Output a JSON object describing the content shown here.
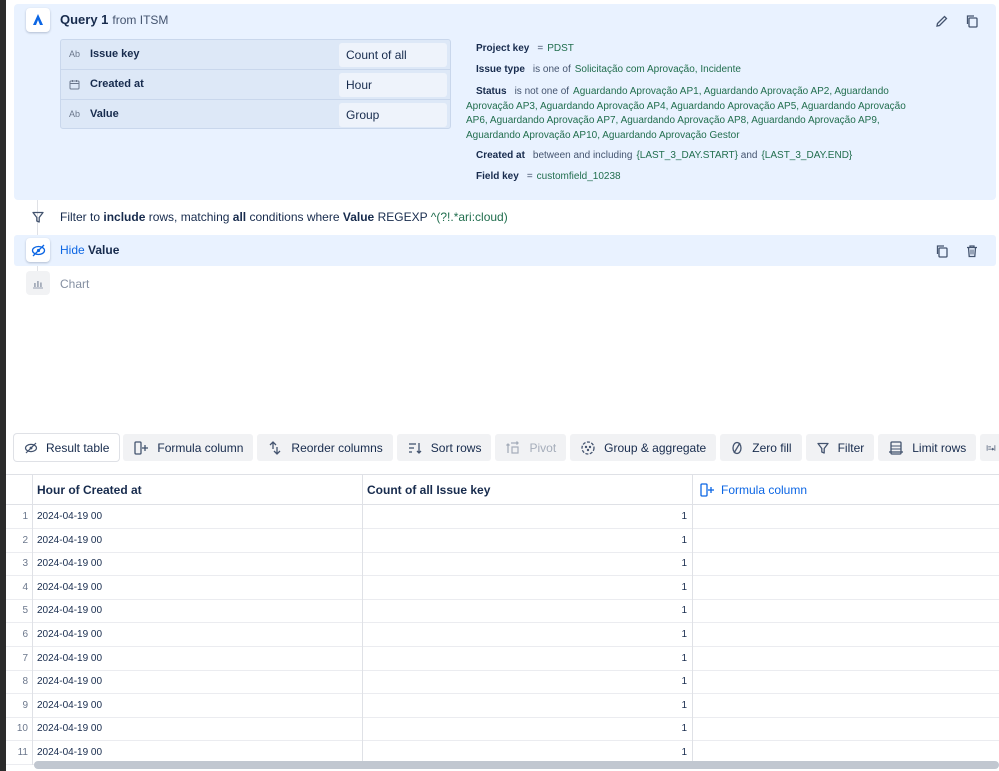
{
  "query": {
    "title": "Query 1",
    "from_label": "from",
    "source": "ITSM",
    "fields": [
      {
        "type": "Ab",
        "name": "Issue key",
        "aggregation": "Count of all"
      },
      {
        "type": "",
        "name": "Created at",
        "aggregation": "Hour"
      },
      {
        "type": "Ab",
        "name": "Value",
        "aggregation": "Group"
      }
    ],
    "conditions": {
      "project": {
        "key": "Project key",
        "op": "=",
        "value": "PDST"
      },
      "issue_type": {
        "key": "Issue type",
        "op": "is one of",
        "values": "Solicitação com Aprovação,  Incidente"
      },
      "status": {
        "key": "Status",
        "op": "is not one of",
        "values": "Aguardando Aprovação AP1,  Aguardando Aprovação AP2,  Aguardando Aprovação AP3,  Aguardando Aprovação AP4,  Aguardando Aprovação AP5,  Aguardando Aprovação AP6,  Aguardando Aprovação AP7,  Aguardando Aprovação AP8,  Aguardando Aprovação AP9,  Aguardando Aprovação AP10,  Aguardando Aprovação Gestor"
      },
      "created_at": {
        "key": "Created at",
        "op": "between and including",
        "start": "{LAST_3_DAY.START}",
        "and": "and",
        "end": "{LAST_3_DAY.END}"
      },
      "field_key": {
        "key": "Field key",
        "op": "=",
        "value": "customfield_10238"
      }
    }
  },
  "filter_step": {
    "t1": "Filter to",
    "include": "include",
    "t2": "rows, matching",
    "all": "all",
    "t3": "conditions where",
    "field": "Value",
    "op": "REGEXP",
    "pattern": "^(?!.*ari:cloud)"
  },
  "hide_step": {
    "action": "Hide",
    "field": "Value"
  },
  "chart_step": {
    "label": "Chart"
  },
  "toolbar": {
    "result_table": "Result table",
    "formula_column": "Formula column",
    "reorder_columns": "Reorder columns",
    "sort_rows": "Sort rows",
    "pivot": "Pivot",
    "group_aggregate": "Group & aggregate",
    "zero_fill": "Zero fill",
    "filter": "Filter",
    "limit_rows": "Limit rows"
  },
  "table": {
    "headers": [
      "Hour of Created at",
      "Count of all Issue key",
      "Formula column"
    ],
    "rows": [
      {
        "n": "1",
        "hour": "2024-04-19 00",
        "count": "1"
      },
      {
        "n": "2",
        "hour": "2024-04-19 00",
        "count": "1"
      },
      {
        "n": "3",
        "hour": "2024-04-19 00",
        "count": "1"
      },
      {
        "n": "4",
        "hour": "2024-04-19 00",
        "count": "1"
      },
      {
        "n": "5",
        "hour": "2024-04-19 00",
        "count": "1"
      },
      {
        "n": "6",
        "hour": "2024-04-19 00",
        "count": "1"
      },
      {
        "n": "7",
        "hour": "2024-04-19 00",
        "count": "1"
      },
      {
        "n": "8",
        "hour": "2024-04-19 00",
        "count": "1"
      },
      {
        "n": "9",
        "hour": "2024-04-19 00",
        "count": "1"
      },
      {
        "n": "10",
        "hour": "2024-04-19 00",
        "count": "1"
      },
      {
        "n": "11",
        "hour": "2024-04-19 00",
        "count": "1"
      }
    ]
  },
  "colors": {
    "accent": "#0c66e4",
    "card_bg": "#e9f2ff",
    "value_green": "#216e4e"
  }
}
